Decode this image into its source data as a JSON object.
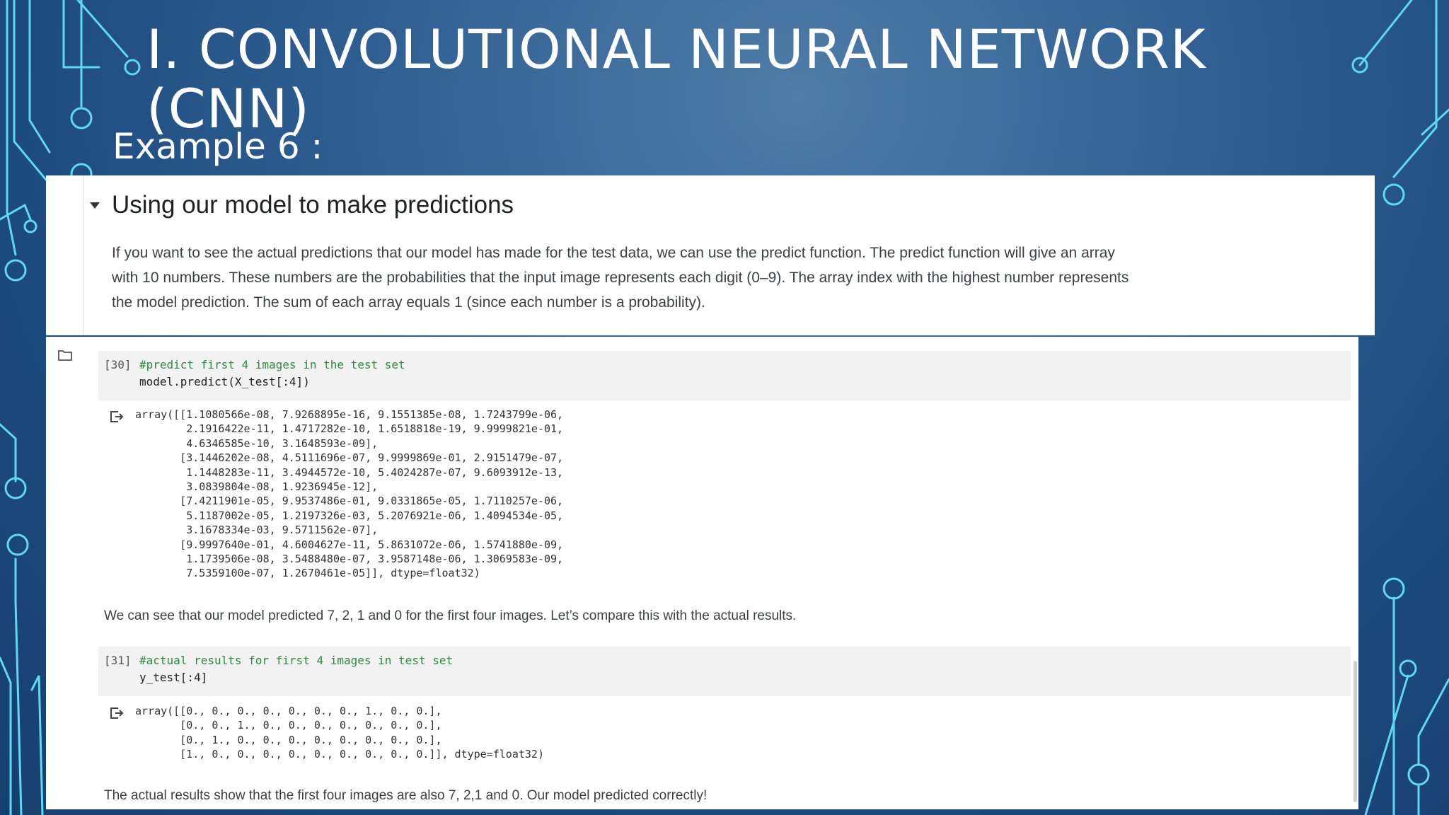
{
  "slide": {
    "title": "I. CONVOLUTIONAL NEURAL NETWORK (CNN)",
    "subtitle": "Example 6 :"
  },
  "notebook": {
    "section_heading": "Using our model to make predictions",
    "intro_text": "If you want to see the actual predictions that our model has made for the test data, we can use the predict function. The predict function will give an array with 10 numbers. These numbers are the probabilities that the input image represents each digit (0–9). The array index with the highest number represents the model prediction. The sum of each array equals 1 (since each number is a probability).",
    "cells": [
      {
        "number": "[30]",
        "comment": "#predict first 4 images in the test set",
        "code": "model.predict(X_test[:4])",
        "output": "array([[1.1080566e-08, 7.9268895e-16, 9.1551385e-08, 1.7243799e-06,\n        2.1916422e-11, 1.4717282e-10, 1.6518818e-19, 9.9999821e-01,\n        4.6346585e-10, 3.1648593e-09],\n       [3.1446202e-08, 4.5111696e-07, 9.9999869e-01, 2.9151479e-07,\n        1.1448283e-11, 3.4944572e-10, 5.4024287e-07, 9.6093912e-13,\n        3.0839804e-08, 1.9236945e-12],\n       [7.4211901e-05, 9.9537486e-01, 9.0331865e-05, 1.7110257e-06,\n        5.1187002e-05, 1.2197326e-03, 5.2076921e-06, 1.4094534e-05,\n        3.1678334e-03, 9.5711562e-07],\n       [9.9997640e-01, 4.6004627e-11, 5.8631072e-06, 1.5741880e-09,\n        1.1739506e-08, 3.5488480e-07, 3.9587148e-06, 1.3069583e-09,\n        7.5359100e-07, 1.2670461e-05]], dtype=float32)"
      },
      {
        "number": "[31]",
        "comment": "#actual results for first 4 images in test set",
        "code": "y_test[:4]",
        "output": "array([[0., 0., 0., 0., 0., 0., 0., 1., 0., 0.],\n       [0., 0., 1., 0., 0., 0., 0., 0., 0., 0.],\n       [0., 1., 0., 0., 0., 0., 0., 0., 0., 0.],\n       [1., 0., 0., 0., 0., 0., 0., 0., 0., 0.]], dtype=float32)"
      }
    ],
    "note_after_predict": "We can see that our model predicted 7, 2, 1 and 0 for the first four images. Let’s compare this with the actual results.",
    "note_after_actual": "The actual results show that the first four images are also 7, 2,1 and 0. Our model predicted correctly!"
  },
  "colors": {
    "background": "#2f5f92",
    "circuit": "#5fd8f5",
    "panel": "#ffffff",
    "code_cell": "#f2f2f2",
    "comment": "#2e8b3e"
  },
  "icons": [
    "collapse-arrow-icon",
    "folder-icon",
    "run-output-icon"
  ]
}
